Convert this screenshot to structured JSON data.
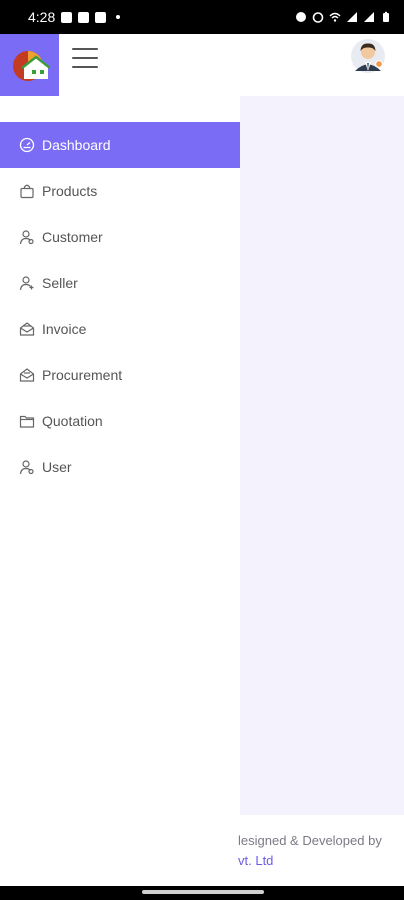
{
  "status_bar": {
    "time": "4:28",
    "left_icons": [
      "image-icon",
      "calendar-icon",
      "message-icon"
    ],
    "right_icons": [
      "alarm-icon",
      "alarm-clock-icon",
      "wifi-icon",
      "signal-icon",
      "signal-icon",
      "battery-icon"
    ]
  },
  "header": {
    "logo_icon": "house-logo-icon",
    "menu_icon": "hamburger-menu-icon",
    "avatar_icon": "user-avatar-icon",
    "accent_color": "#7b6cf6"
  },
  "sidebar": {
    "items": [
      {
        "label": "Dashboard",
        "icon": "dashboard-gauge-icon",
        "active": true
      },
      {
        "label": "Products",
        "icon": "shopping-bag-icon",
        "active": false
      },
      {
        "label": "Customer",
        "icon": "customer-icon",
        "active": false
      },
      {
        "label": "Seller",
        "icon": "seller-icon",
        "active": false
      },
      {
        "label": "Invoice",
        "icon": "invoice-envelope-icon",
        "active": false
      },
      {
        "label": "Procurement",
        "icon": "procurement-envelope-icon",
        "active": false
      },
      {
        "label": "Quotation",
        "icon": "folder-icon",
        "active": false
      },
      {
        "label": "User",
        "icon": "user-icon",
        "active": false
      }
    ]
  },
  "footer": {
    "line1": "lesigned & Developed by",
    "line2": "vt. Ltd"
  }
}
